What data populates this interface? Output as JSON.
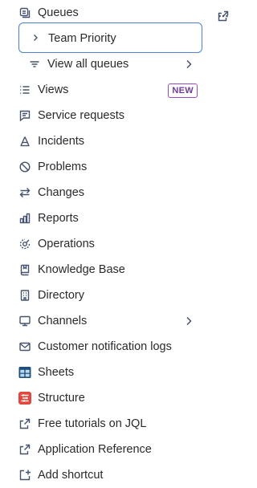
{
  "queues": {
    "label": "Queues"
  },
  "team_priority": {
    "label": "Team Priority"
  },
  "view_all_queues": {
    "label": "View all queues"
  },
  "nav_items": {
    "views": {
      "label": "Views",
      "badge": "NEW"
    },
    "service_requests": {
      "label": "Service requests"
    },
    "incidents": {
      "label": "Incidents"
    },
    "problems": {
      "label": "Problems"
    },
    "changes": {
      "label": "Changes"
    },
    "reports": {
      "label": "Reports"
    },
    "operations": {
      "label": "Operations"
    },
    "knowledge_base": {
      "label": "Knowledge Base"
    },
    "directory": {
      "label": "Directory"
    },
    "channels": {
      "label": "Channels"
    },
    "customer_notification_logs": {
      "label": "Customer notification logs"
    },
    "sheets": {
      "label": "Sheets"
    },
    "structure": {
      "label": "Structure"
    },
    "free_tutorials_jql": {
      "label": "Free tutorials on JQL"
    },
    "application_reference": {
      "label": "Application Reference"
    },
    "add_shortcut": {
      "label": "Add shortcut"
    }
  },
  "colors": {
    "focus_border": "#4c7fd6",
    "badge_border": "#964ac0",
    "badge_text": "#6e3a9c",
    "sheets_icon": "#1d4f7c",
    "structure_icon": "#e2483d"
  }
}
